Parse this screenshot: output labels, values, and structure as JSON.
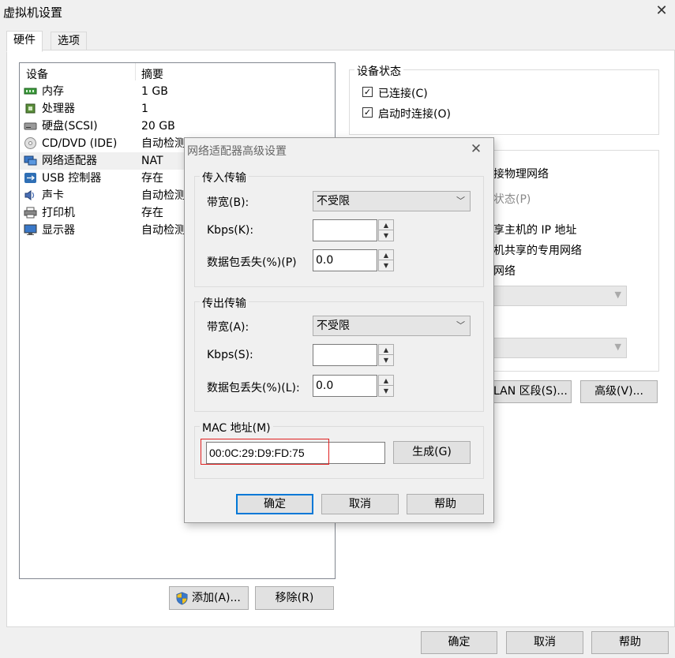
{
  "window": {
    "title": "虚拟机设置"
  },
  "tabs": [
    {
      "label": "硬件"
    },
    {
      "label": "选项"
    }
  ],
  "device_list": {
    "headers": {
      "device": "设备",
      "summary": "摘要"
    },
    "rows": [
      {
        "name": "内存",
        "summary": "1 GB",
        "icon": "memory-icon"
      },
      {
        "name": "处理器",
        "summary": "1",
        "icon": "cpu-icon"
      },
      {
        "name": "硬盘(SCSI)",
        "summary": "20 GB",
        "icon": "harddisk-icon"
      },
      {
        "name": "CD/DVD (IDE)",
        "summary": "自动检测",
        "icon": "cd-icon"
      },
      {
        "name": "网络适配器",
        "summary": "NAT",
        "icon": "network-icon"
      },
      {
        "name": "USB 控制器",
        "summary": "存在",
        "icon": "usb-icon"
      },
      {
        "name": "声卡",
        "summary": "自动检测",
        "icon": "sound-icon"
      },
      {
        "name": "打印机",
        "summary": "存在",
        "icon": "printer-icon"
      },
      {
        "name": "显示器",
        "summary": "自动检测",
        "icon": "monitor-icon"
      }
    ]
  },
  "device_buttons": {
    "add": "添加(A)...",
    "remove": "移除(R)"
  },
  "device_status": {
    "title": "设备状态",
    "connected": "已连接(C)",
    "connect_on_start": "启动时连接(O)"
  },
  "network_conn_visible": {
    "line1": "接物理网络",
    "line2": "状态(P)",
    "line3": "享主机的 IP 地址",
    "line4": "机共享的专用网络",
    "line5": "网络"
  },
  "right_buttons": {
    "lan_segments": "LAN 区段(S)...",
    "advanced": "高级(V)..."
  },
  "footer": {
    "ok": "确定",
    "cancel": "取消",
    "help": "帮助"
  },
  "advanced_dialog": {
    "title": "网络适配器高级设置",
    "incoming": {
      "title": "传入传输",
      "bandwidth_label": "带宽(B):",
      "bandwidth_value": "不受限",
      "kbps_label": "Kbps(K):",
      "kbps_value": "",
      "loss_label": "数据包丢失(%)(P)",
      "loss_value": "0.0"
    },
    "outgoing": {
      "title": "传出传输",
      "bandwidth_label": "带宽(A):",
      "bandwidth_value": "不受限",
      "kbps_label": "Kbps(S):",
      "kbps_value": "",
      "loss_label": "数据包丢失(%)(L):",
      "loss_value": "0.0"
    },
    "mac": {
      "title": "MAC 地址(M)",
      "value": "00:0C:29:D9:FD:75",
      "generate": "生成(G)"
    },
    "buttons": {
      "ok": "确定",
      "cancel": "取消",
      "help": "帮助"
    }
  },
  "colors": {
    "accent": "#0078d7",
    "highlight": "#e02020"
  }
}
